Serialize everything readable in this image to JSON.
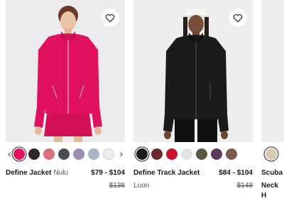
{
  "products": [
    {
      "name": "Define Jacket",
      "fabric": "Nulu",
      "price": "$79 - $104",
      "original_price": "$138",
      "wishlist_icon": "heart-outline-icon",
      "swatches": [
        "#e0115f",
        "#2a2a2a",
        "#d9707a",
        "#4a4d50",
        "#9c8fb0",
        "#aab4c4",
        "#ededed"
      ],
      "selected_swatch": 0,
      "has_arrows": true
    },
    {
      "name": "Define Track Jacket",
      "fabric": "Luon",
      "price": "$84 - $104",
      "original_price": "$148",
      "wishlist_icon": "heart-outline-icon",
      "swatches": [
        "#1c1c1c",
        "#6b2a2f",
        "#c9102f",
        "#e2e2e2",
        "#5a5640",
        "#5c3a5c",
        "#7a5a4a"
      ],
      "selected_swatch": 0,
      "has_arrows": false
    },
    {
      "name": "Scuba",
      "fabric": "Neck H",
      "swatches": [
        "#d9cbb0"
      ],
      "selected_swatch": 0
    }
  ],
  "colors": {
    "accent_pink": "#e0115f",
    "text": "#1a1a1a",
    "muted": "#555555"
  }
}
